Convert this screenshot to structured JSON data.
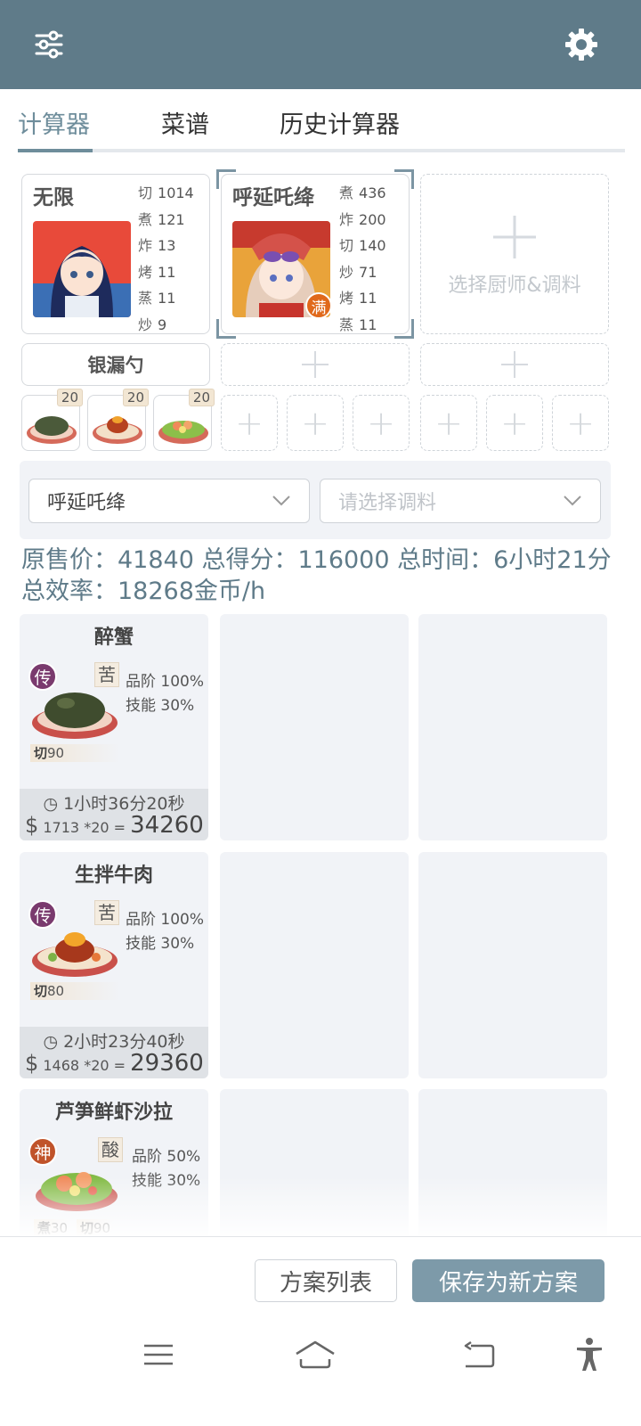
{
  "header": {
    "filter_icon": "sliders-icon",
    "settings_icon": "gear-icon"
  },
  "tabs": [
    {
      "label": "计算器",
      "active": true
    },
    {
      "label": "菜谱",
      "active": false
    },
    {
      "label": "历史计算器",
      "active": false
    }
  ],
  "chefs": [
    {
      "name": "无限",
      "stats": [
        [
          "切",
          "1014"
        ],
        [
          "煮",
          "121"
        ],
        [
          "炸",
          "13"
        ],
        [
          "烤",
          "11"
        ],
        [
          "蒸",
          "11"
        ],
        [
          "炒",
          "9"
        ]
      ],
      "badge": ""
    },
    {
      "name": "呼延吒绛",
      "stats": [
        [
          "煮",
          "436"
        ],
        [
          "炸",
          "200"
        ],
        [
          "切",
          "140"
        ],
        [
          "炒",
          "71"
        ],
        [
          "烤",
          "11"
        ],
        [
          "蒸",
          "11"
        ]
      ],
      "badge": "满"
    }
  ],
  "add_chef_label": "选择厨师&调料",
  "equipment": {
    "name": "银漏勺"
  },
  "dish_quantities": [
    "20",
    "20",
    "20"
  ],
  "selects": {
    "chef_value": "呼延吒绛",
    "condiment_placeholder": "请选择调料"
  },
  "summary": {
    "text": "原售价：41840 总得分：116000 总时间：6小时21分 总效率：18268金币/h"
  },
  "dishes": [
    {
      "name": "醉蟹",
      "rarity": "传",
      "rarity_color": "#7a3a6e",
      "taste": "苦",
      "quality": "品阶 100%",
      "skill": "技能 30%",
      "req1_k": "切",
      "req1_v": "90",
      "req2_k": "",
      "req2_v": "",
      "time": "1小时36分20秒",
      "unit_price": "1713",
      "qty": "*20",
      "total": "34260"
    },
    {
      "name": "生拌牛肉",
      "rarity": "传",
      "rarity_color": "#7a3a6e",
      "taste": "苦",
      "quality": "品阶 100%",
      "skill": "技能 30%",
      "req1_k": "切",
      "req1_v": "80",
      "req2_k": "",
      "req2_v": "",
      "time": "2小时23分40秒",
      "unit_price": "1468",
      "qty": "*20",
      "total": "29360"
    },
    {
      "name": "芦笋鲜虾沙拉",
      "rarity": "神",
      "rarity_color": "#c0532a",
      "taste": "酸",
      "quality": "品阶 50%",
      "skill": "技能 30%",
      "req1_k": "煮",
      "req1_v": "30",
      "req2_k": "切",
      "req2_v": "90",
      "time": "",
      "unit_price": "",
      "qty": "",
      "total": ""
    }
  ],
  "buttons": {
    "plan_list": "方案列表",
    "save_new": "保存为新方案"
  },
  "colors": {
    "header": "#5f7b89",
    "accent": "#6e8d9b",
    "primary_button": "#7d9aa9"
  }
}
